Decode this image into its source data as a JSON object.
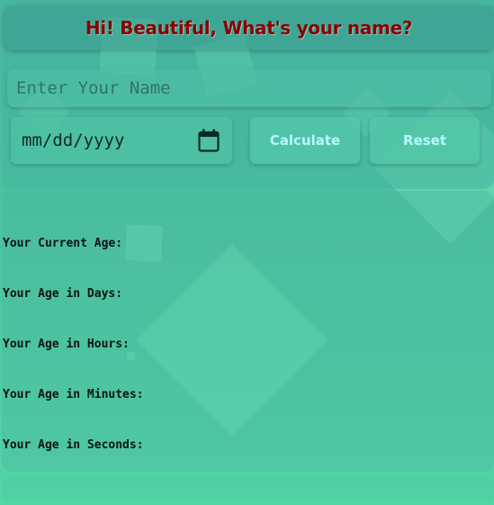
{
  "header": {
    "title": "Hi! Beautiful, What's your name?"
  },
  "form": {
    "name_placeholder": "Enter Your Name",
    "date_value": "mm/dd/yyyy",
    "calendar_icon": "calendar-icon",
    "calculate_label": "Calculate",
    "reset_label": "Reset"
  },
  "results": {
    "current_age": "Your Current Age:",
    "days": "Your Age in Days:",
    "hours": "Your Age in Hours:",
    "minutes": "Your Age in Minutes:",
    "seconds": "Your Age in Seconds:"
  },
  "colors": {
    "title": "#8b0000",
    "button_text": "#b9f7ff",
    "background": "#4cc39f"
  }
}
